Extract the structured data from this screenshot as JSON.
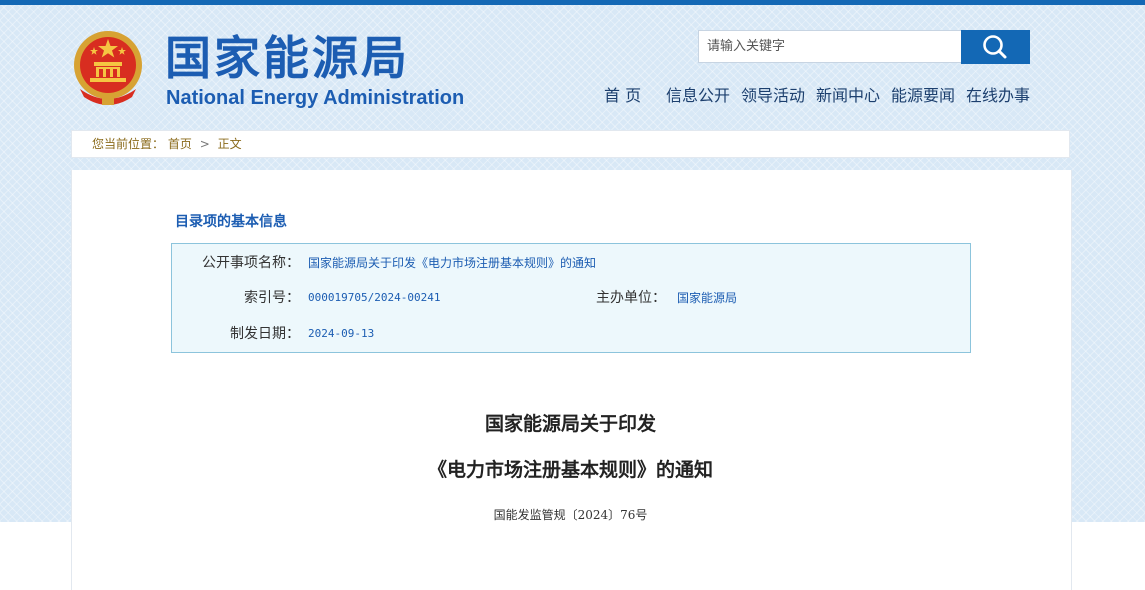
{
  "header": {
    "title_cn": "国家能源局",
    "title_en": "National Energy Administration",
    "search_placeholder": "请输入关键字",
    "nav": [
      "首 页",
      "信息公开",
      "领导活动",
      "新闻中心",
      "能源要闻",
      "在线办事"
    ]
  },
  "breadcrumb": {
    "prefix": "您当前位置：",
    "home": "首页",
    "separator": ">",
    "current": "正文"
  },
  "catalog": {
    "heading": "目录项的基本信息",
    "item_name_label": "公开事项名称：",
    "item_name_value": "国家能源局关于印发《电力市场注册基本规则》的通知",
    "index_label": "索引号：",
    "index_value": "000019705/2024-00241",
    "host_label": "主办单位：",
    "host_value": "国家能源局",
    "date_label": "制发日期：",
    "date_value": "2024-09-13"
  },
  "document": {
    "title_line1": "国家能源局关于印发",
    "title_line2": "《电力市场注册基本规则》的通知",
    "doc_number": "国能发监管规〔2024〕76号"
  },
  "colors": {
    "brand_blue": "#1c5db2",
    "search_button": "#1368b5",
    "info_box_bg": "#edf8fc",
    "info_box_border": "#8cc4dc"
  }
}
